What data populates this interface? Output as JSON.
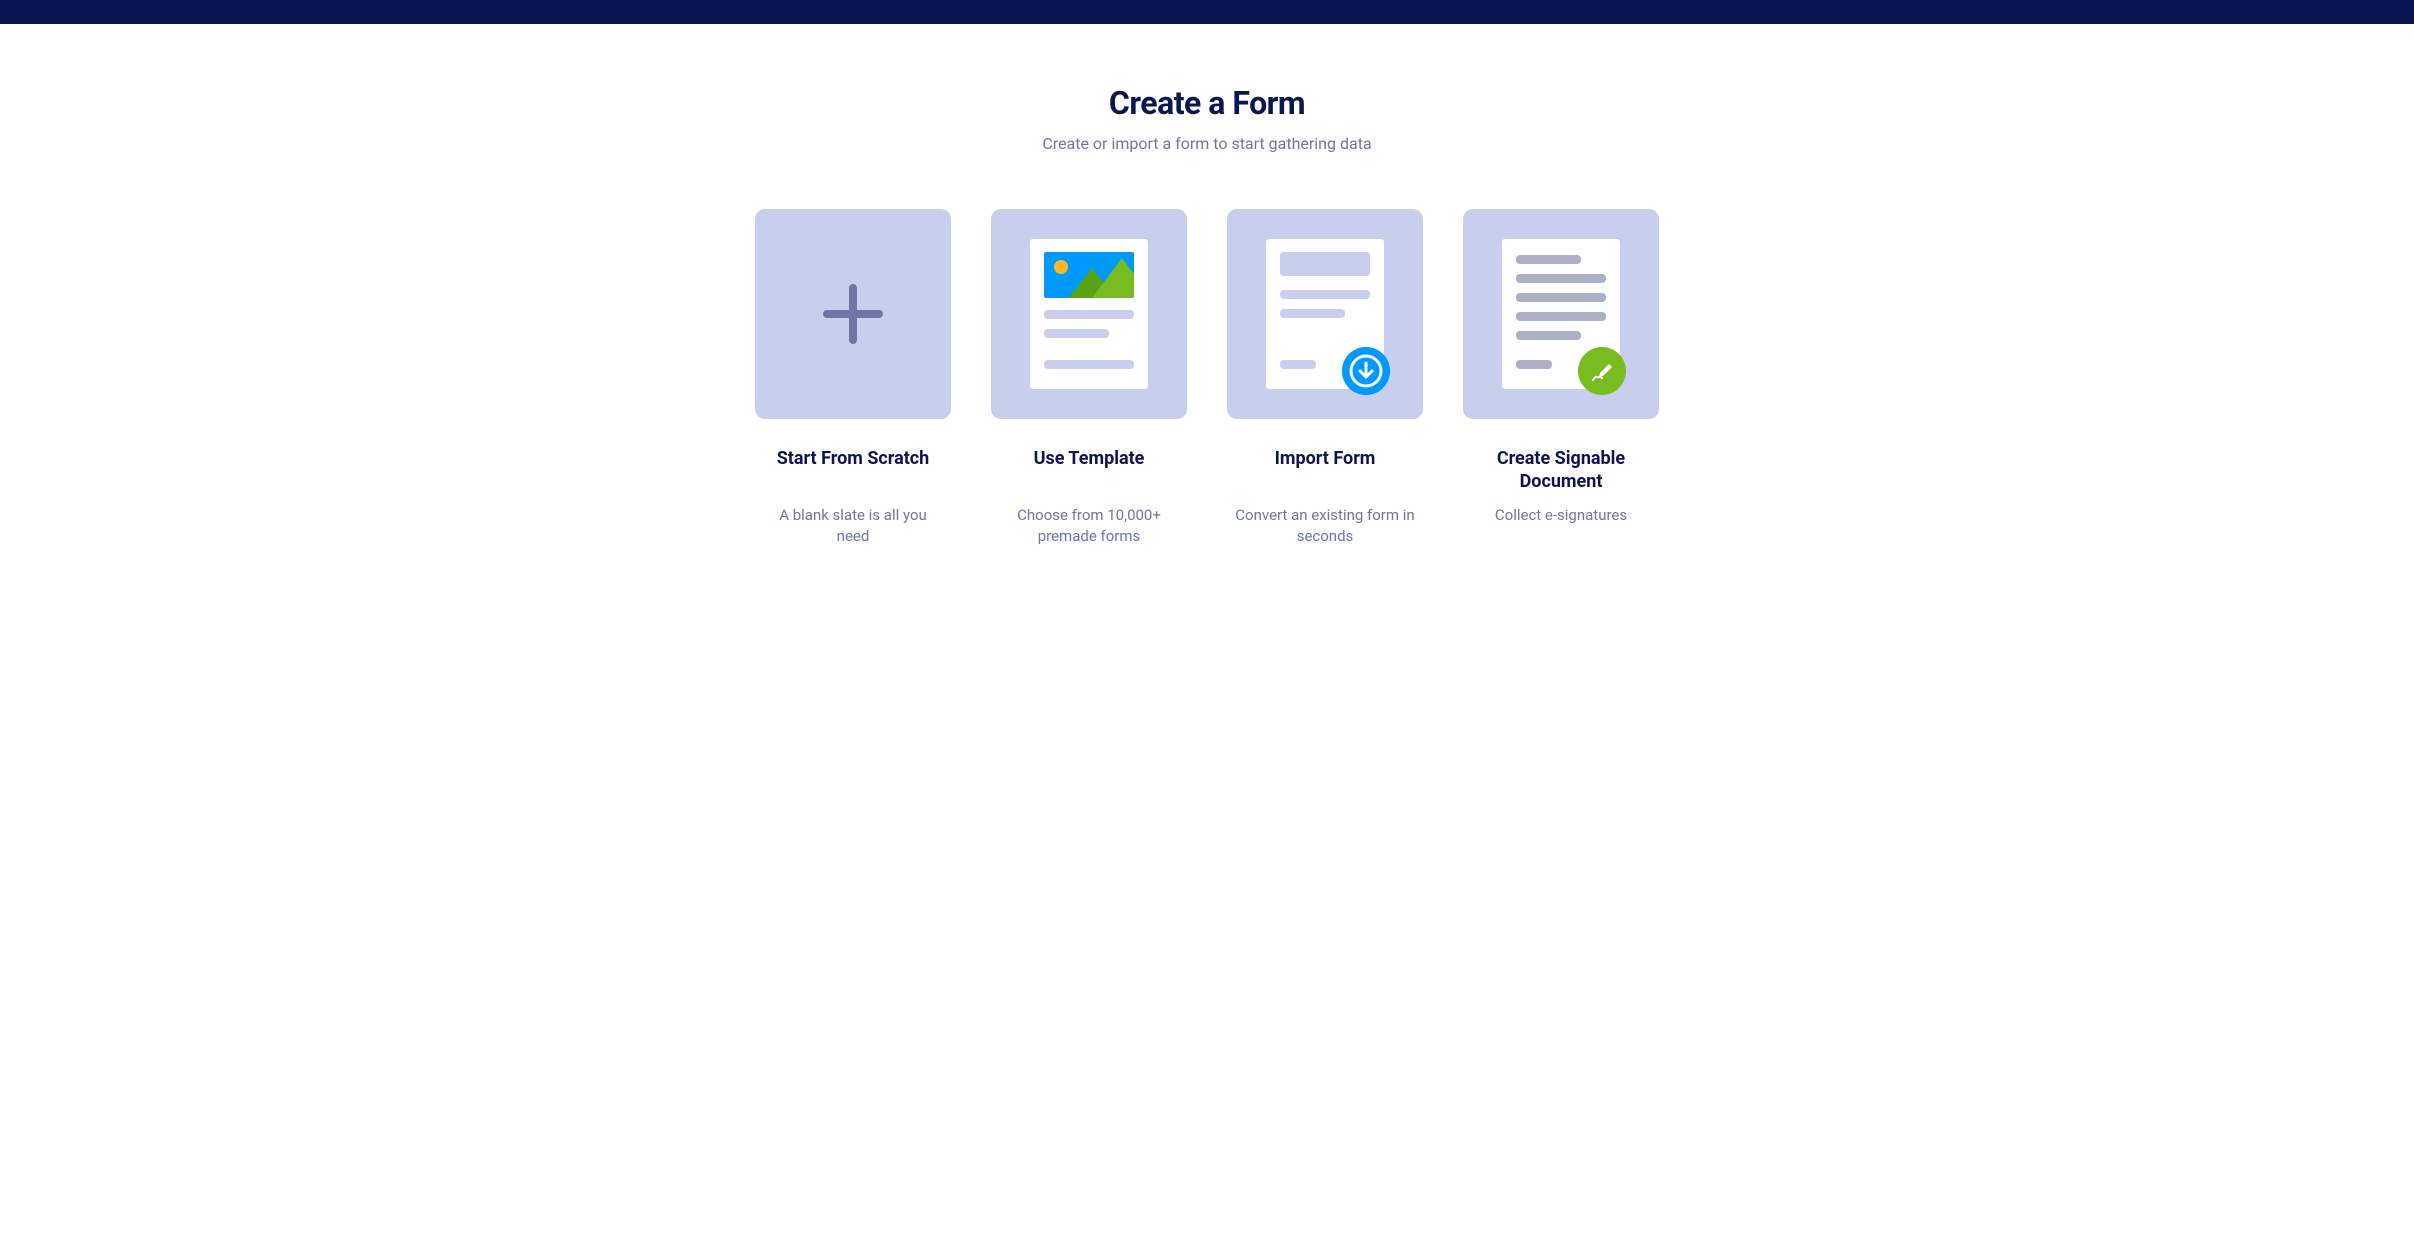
{
  "header": {
    "title": "Create a Form",
    "subtitle": "Create or import a form to start gathering data"
  },
  "options": [
    {
      "title": "Start From Scratch",
      "description": "A blank slate is all you need"
    },
    {
      "title": "Use Template",
      "description": "Choose from 10,000+ premade forms"
    },
    {
      "title": "Import Form",
      "description": "Convert an existing form in seconds"
    },
    {
      "title": "Create Signable Document",
      "description": "Collect e-signatures"
    }
  ],
  "colors": {
    "top_bar": "#0a1551",
    "tile": "#c8ceed",
    "title_text": "#0a1551",
    "muted_text": "#6f76a7",
    "accent_blue": "#0099ff",
    "accent_green": "#78bc20"
  }
}
